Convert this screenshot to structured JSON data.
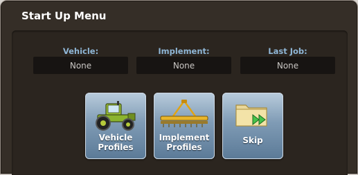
{
  "title": "Start Up Menu",
  "fields": [
    {
      "label": "Vehicle:",
      "value": "None"
    },
    {
      "label": "Implement:",
      "value": "None"
    },
    {
      "label": "Last Job:",
      "value": "None"
    }
  ],
  "buttons": {
    "vehicle_profiles": {
      "label": "Vehicle\nProfiles",
      "icon": "tractor-icon"
    },
    "implement_profiles": {
      "label": "Implement\nProfiles",
      "icon": "implement-icon"
    },
    "skip": {
      "label": "Skip",
      "icon": "folder-skip-icon"
    }
  },
  "colors": {
    "background": "#352e27",
    "label_blue": "#8fb6d6",
    "tile_blue": "#7f9bb5"
  }
}
